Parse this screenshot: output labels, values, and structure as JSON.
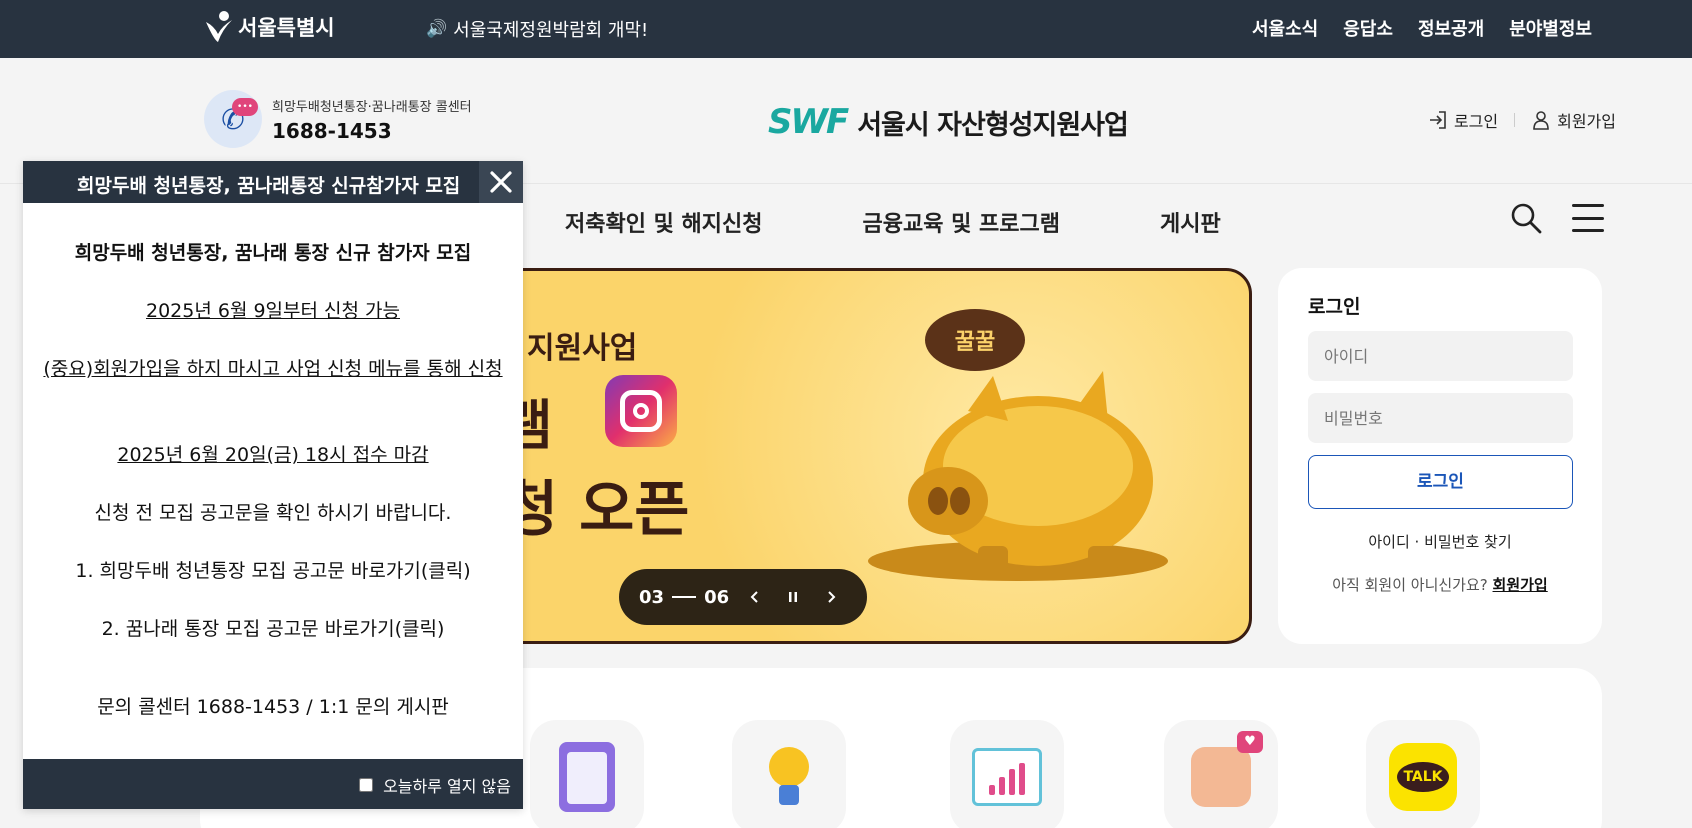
{
  "topbar": {
    "logo_text": "서울특별시",
    "notice": "서울국제정원박람회 개막!",
    "links": [
      "서울소식",
      "응답소",
      "정보공개",
      "분야별정보"
    ]
  },
  "header": {
    "callcenter_label": "희망두배청년통장·꿈나래통장 콜센터",
    "callcenter_number": "1688-1453",
    "brand_mark": "SWF",
    "brand_name": "서울시 자산형성지원사업",
    "login": "로그인",
    "signup": "회원가입"
  },
  "nav": {
    "items": [
      "저축확인 및 해지신청",
      "금융교육 및 프로그램",
      "게시판"
    ]
  },
  "banner": {
    "line1": "지원사업",
    "line2": "램",
    "line3": "청 오픈",
    "speech": "꿀꿀",
    "counter_current": "03",
    "counter_total": "06"
  },
  "login_card": {
    "title": "로그인",
    "id_placeholder": "아이디",
    "pw_placeholder": "비밀번호",
    "submit": "로그인",
    "find": "아이디 · 비밀번호 찾기",
    "join_prompt": "아직 회원이 아니신가요?",
    "join_link": "회원가입"
  },
  "popup": {
    "title": "희망두배 청년통장, 꿈나래통장 신규참가자 모집",
    "heading": "희망두배 청년통장, 꿈나래 통장 신규 참가자 모집",
    "date_open": "2025년  6월 9일부터 신청 가능",
    "important": "(중요)회원가입을 하지 마시고 사업 신청 메뉴를 통해 신청",
    "deadline": "2025년 6월 20일(금) 18시 접수 마감",
    "check": "신청 전 모집 공고문을 확인 하시기 바랍니다.",
    "link1": "1. 희망두배 청년통장 모집 공고문 바로가기(클릭)",
    "link2": "2. 꿈나래 통장 모집 공고문 바로가기(클릭)",
    "contact": "문의 콜센터 1688-1453  / 1:1 문의 게시판",
    "dont_show": "오늘하루 열지 않음"
  },
  "quick_menu": {
    "icons": [
      "clipboard-icon",
      "lightbulb-icon",
      "chart-board-icon",
      "thumbs-up-icon",
      "kakaotalk-icon"
    ],
    "talk_label": "TALK"
  },
  "colors": {
    "dark_bar": "#283340",
    "brand_teal": "#1aa8a0",
    "login_blue": "#1b56b8",
    "banner_yellow": "#fbd46a"
  }
}
